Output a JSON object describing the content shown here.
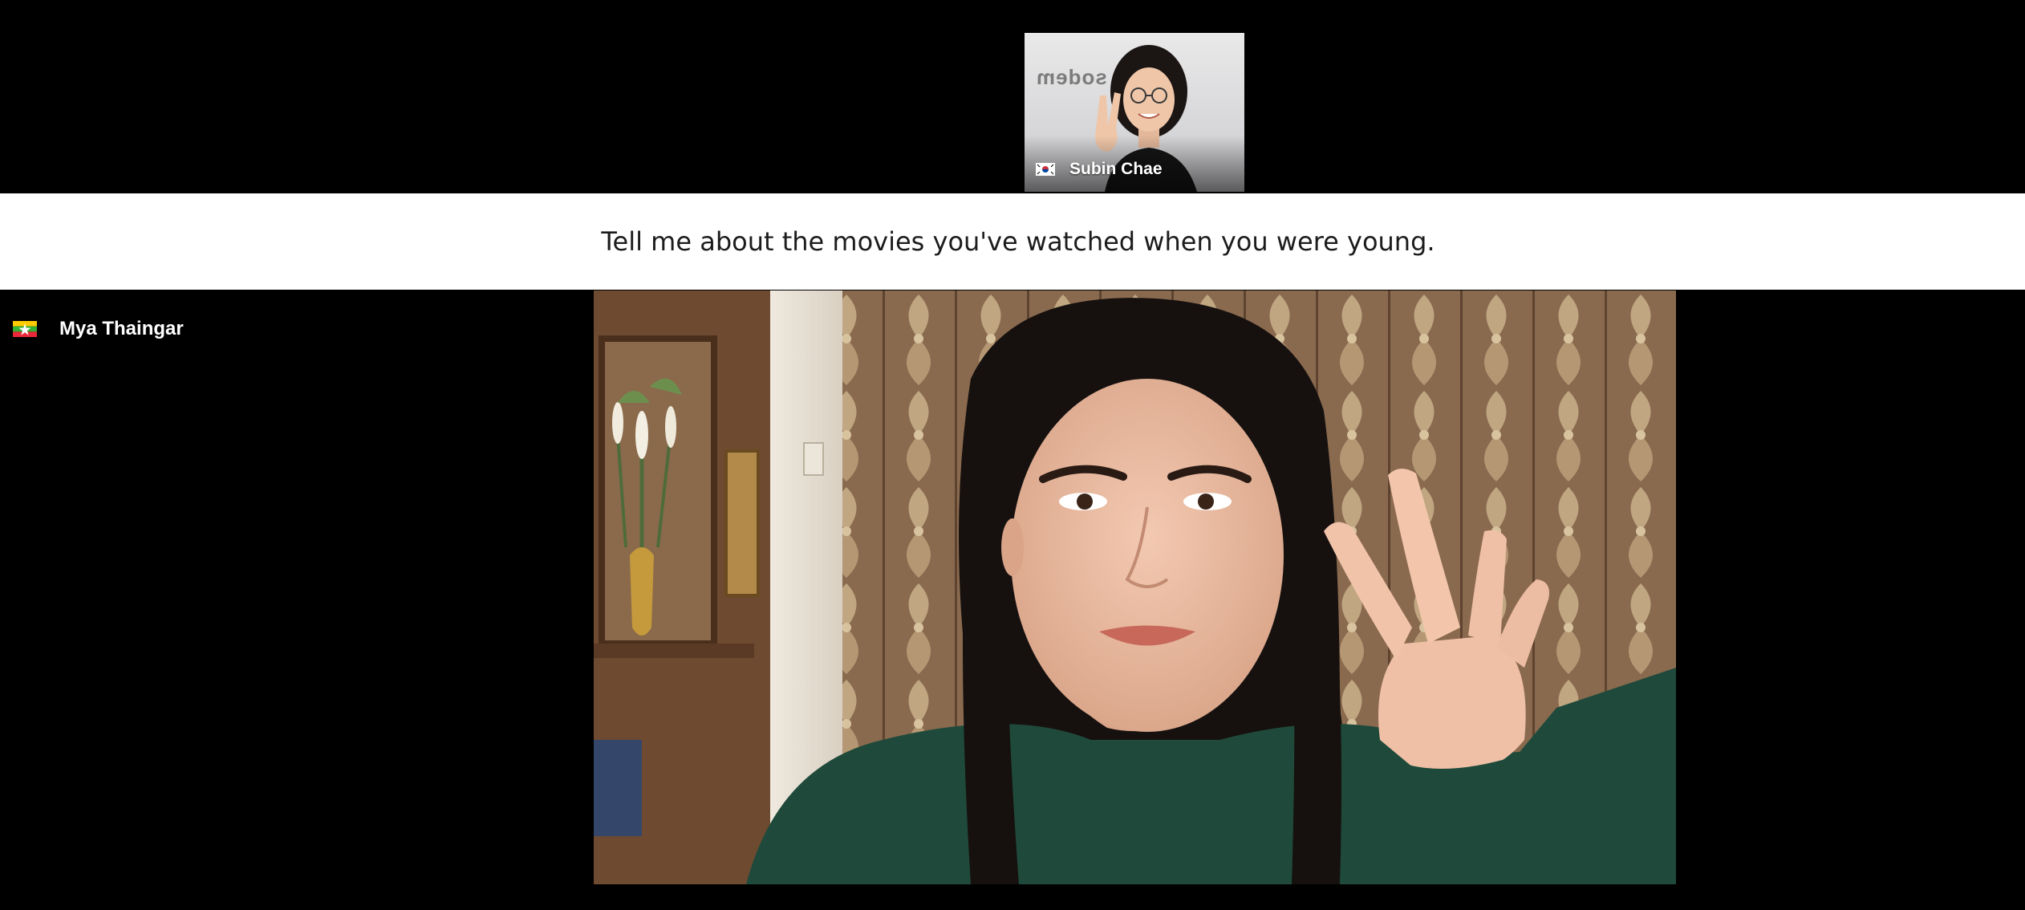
{
  "participants": {
    "thumbnail": {
      "name": "Subin Chae",
      "flag_icon": "south-korea-flag-icon",
      "wall_text": "sodem"
    },
    "main_speaker": {
      "name": "Mya Thaingar",
      "flag_icon": "myanmar-flag-icon"
    }
  },
  "caption": {
    "text": "Tell me about the movies you've watched when you were young."
  },
  "colors": {
    "background": "#000000",
    "caption_bar": "#ffffff",
    "caption_text": "#1c1c1c",
    "name_text": "#ffffff"
  }
}
